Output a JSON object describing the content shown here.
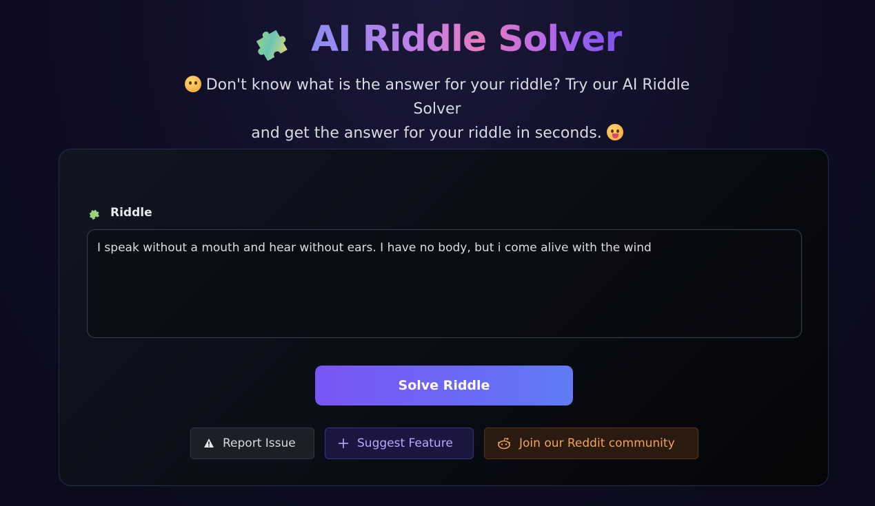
{
  "header": {
    "title": "AI Riddle Solver",
    "title_icon": "puzzle-icon",
    "subtitle_line1": "Don't know what is the answer for your riddle? Try our AI Riddle Solver",
    "subtitle_line2": "and get the answer for your riddle in seconds.",
    "subtitle_emoji_start": "thinking-face-icon",
    "subtitle_emoji_end": "tongue-face-icon"
  },
  "form": {
    "riddle_label": "Riddle",
    "riddle_icon": "puzzle-icon",
    "riddle_value": "I speak without a mouth and hear without ears. I have no body, but i come alive with the wind",
    "solve_label": "Solve Riddle"
  },
  "actions": {
    "report_label": "Report Issue",
    "report_icon": "warning-icon",
    "suggest_label": "Suggest Feature",
    "suggest_icon": "plus-icon",
    "reddit_label": "Join our Reddit community",
    "reddit_icon": "reddit-icon"
  },
  "colors": {
    "accent_purple": "#7a55f5",
    "accent_blue": "#5f7cf3",
    "reddit_orange": "#f3a25a",
    "suggest_violet": "#b9a8ff"
  }
}
